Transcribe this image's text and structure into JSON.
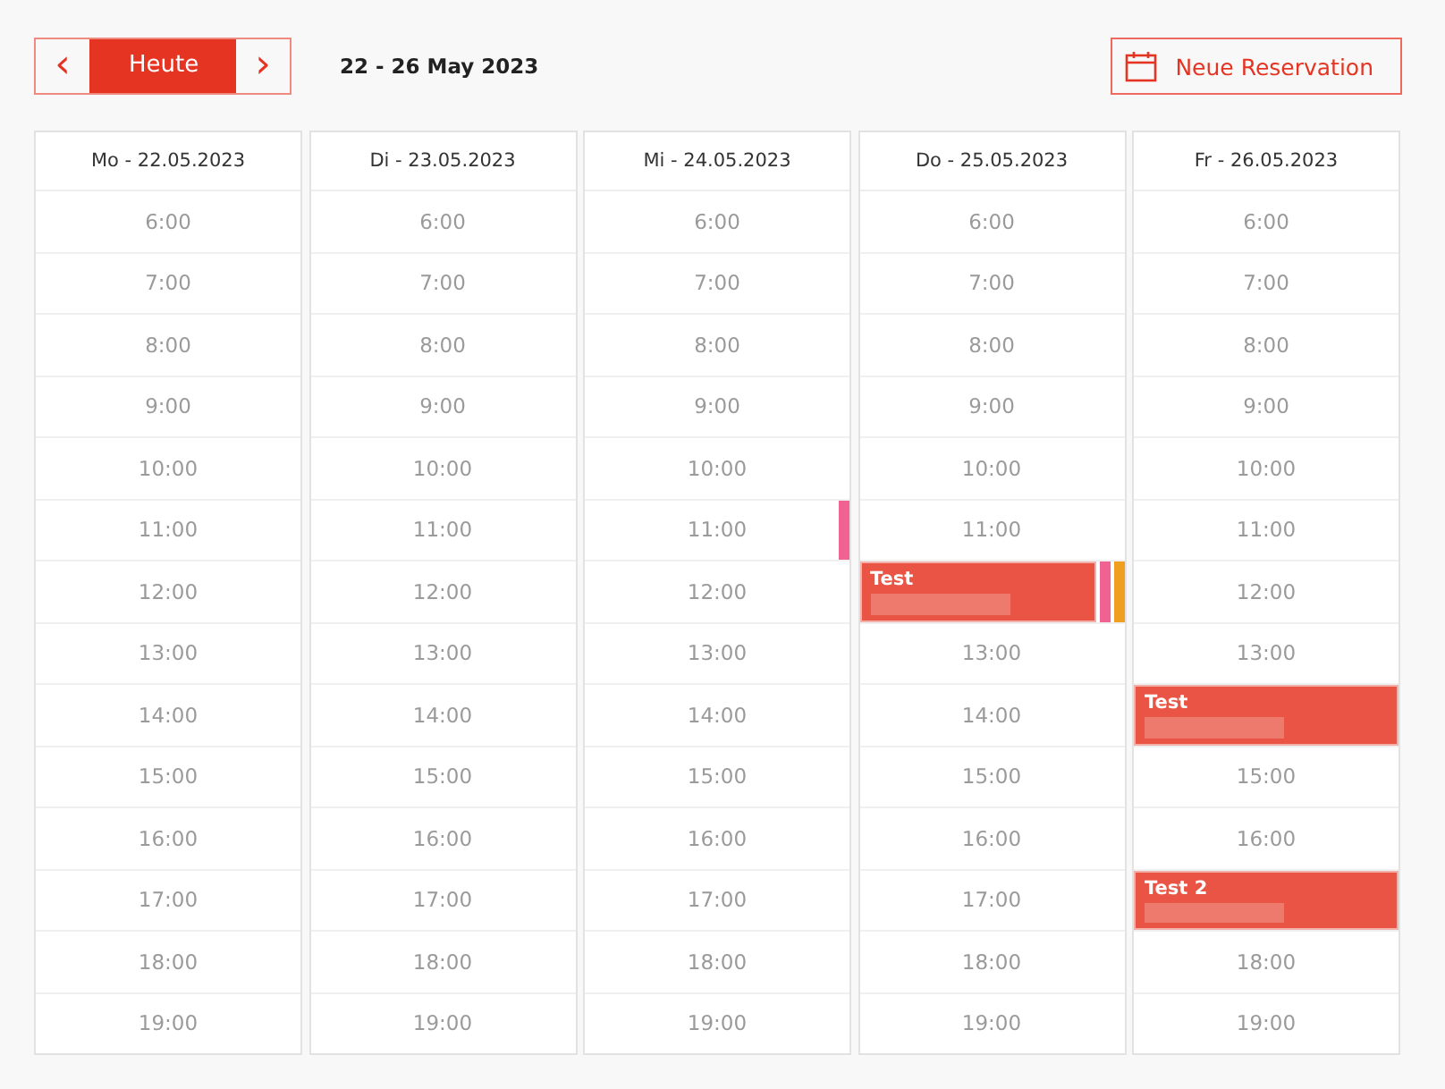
{
  "toolbar": {
    "prev": "‹",
    "today": "Heute",
    "next": "›",
    "range": "22 - 26 May 2023",
    "new_button": "Neue Reservation"
  },
  "days": [
    {
      "label": "Mo - 22.05.2023",
      "slots": [
        {
          "time": "6:00"
        },
        {
          "time": "7:00"
        },
        {
          "time": "8:00"
        },
        {
          "time": "9:00"
        },
        {
          "time": "10:00"
        },
        {
          "time": "11:00"
        },
        {
          "time": "12:00"
        },
        {
          "time": "13:00"
        },
        {
          "time": "14:00"
        },
        {
          "time": "15:00"
        },
        {
          "time": "16:00"
        },
        {
          "time": "17:00"
        },
        {
          "time": "18:00"
        },
        {
          "time": "19:00"
        }
      ]
    },
    {
      "label": "Di - 23.05.2023",
      "slots": [
        {
          "time": "6:00"
        },
        {
          "time": "7:00"
        },
        {
          "time": "8:00"
        },
        {
          "time": "9:00"
        },
        {
          "time": "10:00"
        },
        {
          "time": "11:00"
        },
        {
          "time": "12:00"
        },
        {
          "time": "13:00"
        },
        {
          "time": "14:00"
        },
        {
          "time": "15:00"
        },
        {
          "time": "16:00"
        },
        {
          "time": "17:00"
        },
        {
          "time": "18:00"
        },
        {
          "time": "19:00"
        }
      ]
    },
    {
      "label": "Mi - 24.05.2023",
      "slots": [
        {
          "time": "6:00"
        },
        {
          "time": "7:00"
        },
        {
          "time": "8:00"
        },
        {
          "time": "9:00"
        },
        {
          "time": "10:00"
        },
        {
          "time": "11:00",
          "events": [
            {
              "kind": "strip",
              "color": "#f06292"
            }
          ]
        },
        {
          "time": "12:00"
        },
        {
          "time": "13:00"
        },
        {
          "time": "14:00"
        },
        {
          "time": "15:00"
        },
        {
          "time": "16:00"
        },
        {
          "time": "17:00"
        },
        {
          "time": "18:00"
        },
        {
          "time": "19:00"
        }
      ]
    },
    {
      "label": "Do - 25.05.2023",
      "slots": [
        {
          "time": "6:00"
        },
        {
          "time": "7:00"
        },
        {
          "time": "8:00"
        },
        {
          "time": "9:00"
        },
        {
          "time": "10:00"
        },
        {
          "time": "11:00"
        },
        {
          "events": [
            {
              "kind": "block",
              "title": "Test",
              "color": "#e95444"
            },
            {
              "kind": "strip",
              "color": "#f06292"
            },
            {
              "kind": "strip",
              "color": "#f0a020"
            }
          ]
        },
        {
          "time": "13:00"
        },
        {
          "time": "14:00"
        },
        {
          "time": "15:00"
        },
        {
          "time": "16:00"
        },
        {
          "time": "17:00"
        },
        {
          "time": "18:00"
        },
        {
          "time": "19:00"
        }
      ]
    },
    {
      "label": "Fr - 26.05.2023",
      "slots": [
        {
          "time": "6:00"
        },
        {
          "time": "7:00"
        },
        {
          "time": "8:00"
        },
        {
          "time": "9:00"
        },
        {
          "time": "10:00"
        },
        {
          "time": "11:00"
        },
        {
          "time": "12:00"
        },
        {
          "time": "13:00"
        },
        {
          "events": [
            {
              "kind": "block",
              "title": "Test",
              "color": "#e95444"
            }
          ]
        },
        {
          "time": "15:00"
        },
        {
          "time": "16:00"
        },
        {
          "events": [
            {
              "kind": "block",
              "title": "Test 2",
              "color": "#e95444"
            }
          ]
        },
        {
          "time": "18:00"
        },
        {
          "time": "19:00"
        }
      ]
    }
  ]
}
